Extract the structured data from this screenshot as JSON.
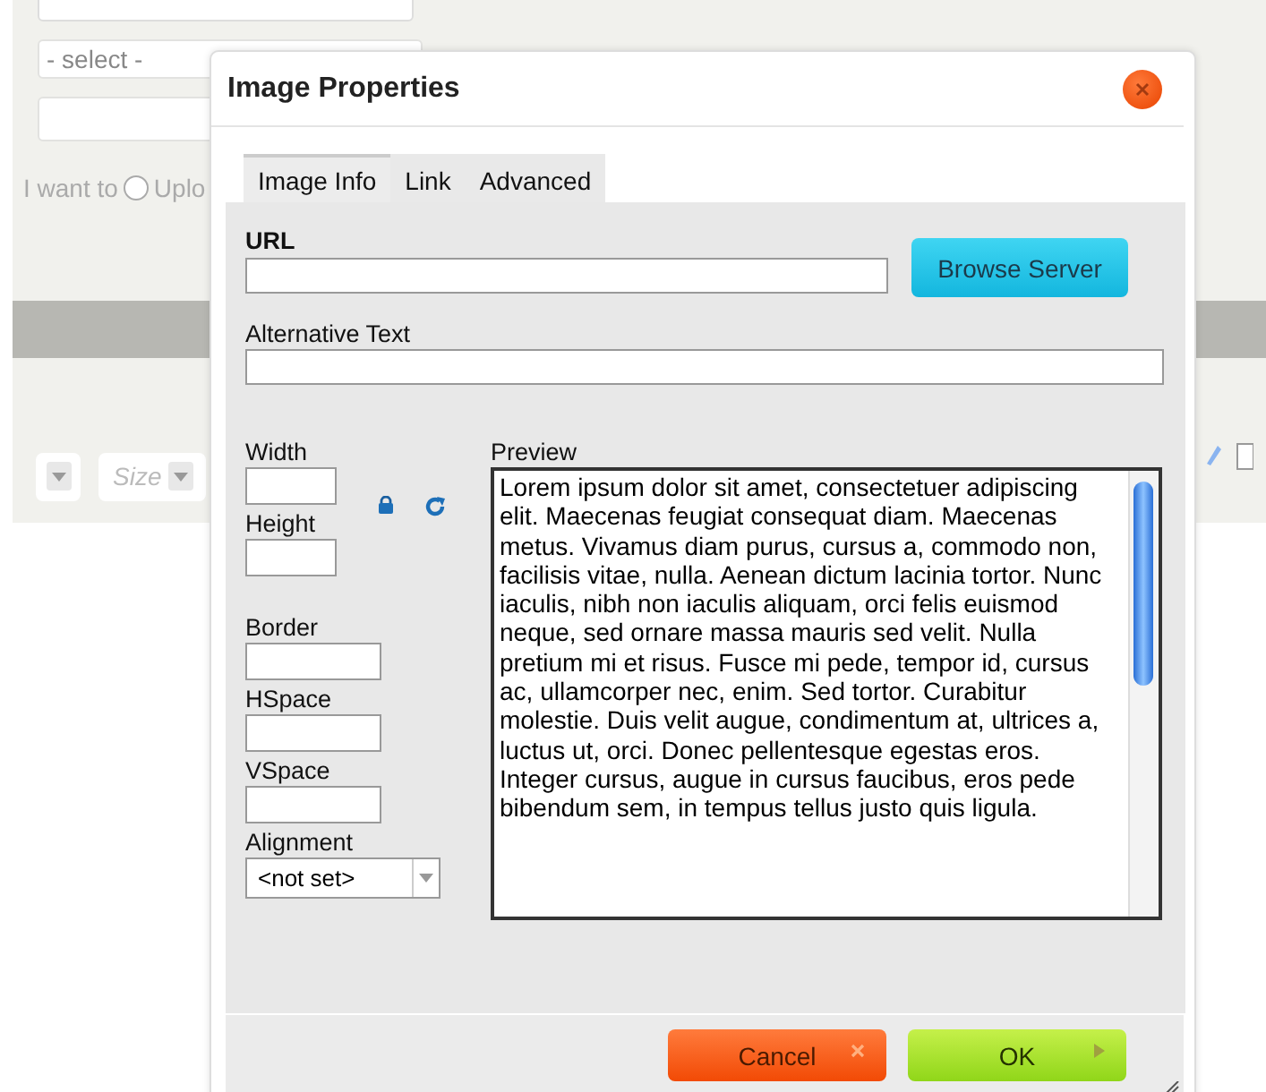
{
  "background_page": {
    "select": {
      "value": "- select -"
    },
    "upload_choice": {
      "prefix": "I want to",
      "option": "Uplo",
      "checked": false
    },
    "toolbar": {
      "size_dropdown": {
        "placeholder": "Size"
      }
    }
  },
  "dialog": {
    "title": "Image Properties",
    "tabs": [
      {
        "label": "Image Info",
        "selected": true
      },
      {
        "label": "Link",
        "selected": false
      },
      {
        "label": "Advanced",
        "selected": false
      }
    ],
    "url_label": "URL",
    "browse_button": "Browse Server",
    "alt_text_label": "Alternative Text",
    "size_fields": [
      {
        "label": "Width"
      },
      {
        "label": "Height"
      }
    ],
    "spacing_fields": [
      {
        "label": "Border"
      },
      {
        "label": "HSpace"
      },
      {
        "label": "VSpace"
      }
    ],
    "alignment": {
      "label": "Alignment",
      "value": "<not set>"
    },
    "preview": {
      "label": "Preview",
      "text": "Lorem ipsum dolor sit amet, consectetuer adipiscing elit. Maecenas feugiat consequat diam. Maecenas metus. Vivamus diam purus, cursus a, commodo non, facilisis vitae, nulla. Aenean dictum lacinia tortor. Nunc iaculis, nibh non iaculis aliquam, orci felis euismod neque, sed ornare massa mauris sed velit. Nulla pretium mi et risus. Fusce mi pede, tempor id, cursus ac, ullamcorper nec, enim. Sed tortor. Curabitur molestie. Duis velit augue, condimentum at, ultrices a, luctus ut, orci. Donec pellentesque egestas eros. Integer cursus, augue in cursus faucibus, eros pede bibendum sem, in tempus tellus justo quis ligula."
    },
    "buttons": [
      {
        "kind": "cancel",
        "label": "Cancel"
      },
      {
        "kind": "ok",
        "label": "OK"
      }
    ]
  }
}
